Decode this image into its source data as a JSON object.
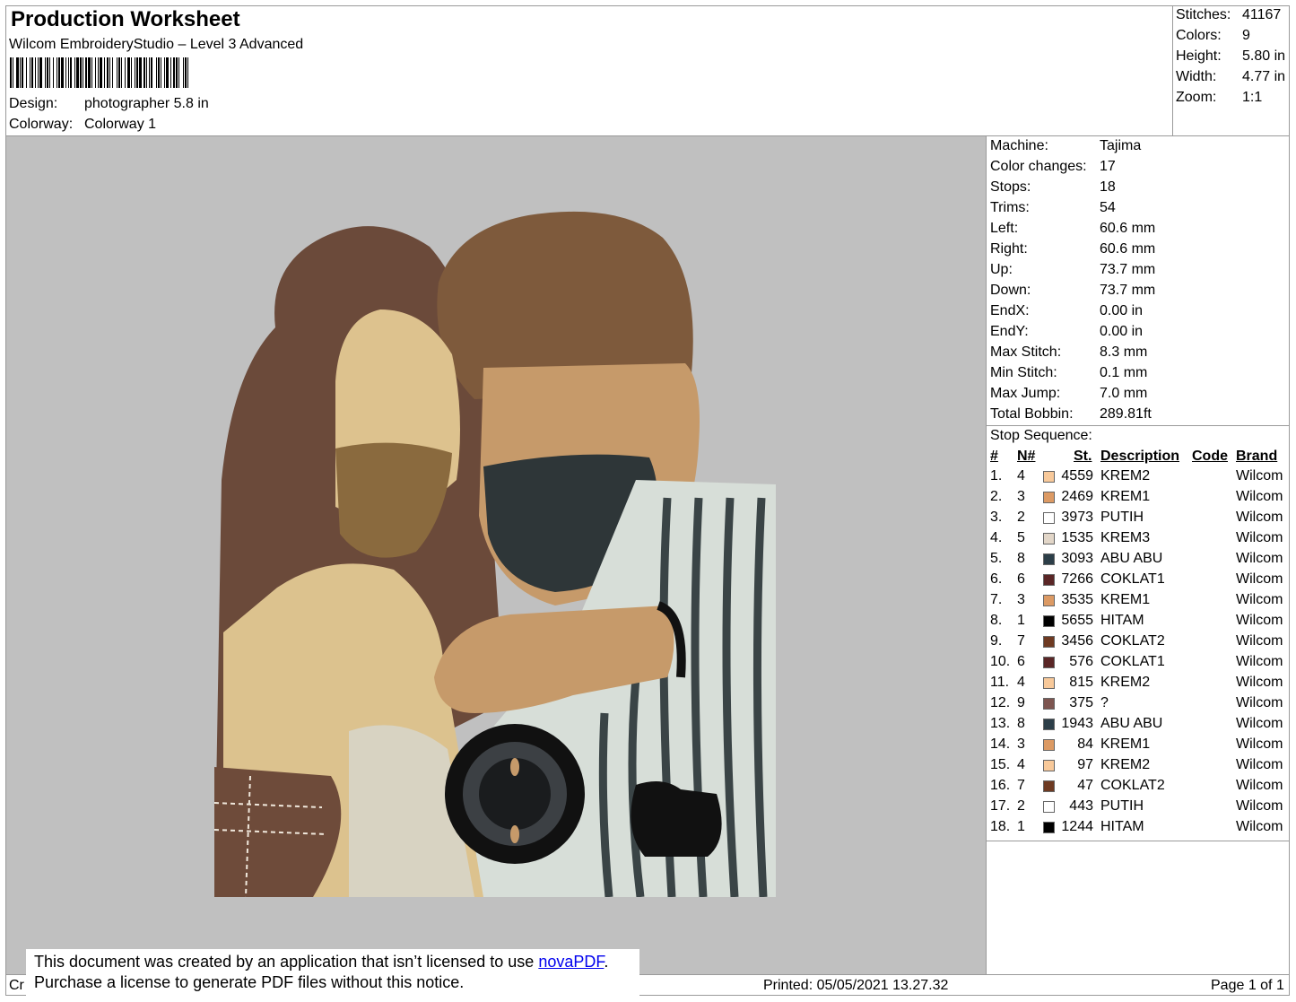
{
  "header": {
    "title": "Production Worksheet",
    "software": "Wilcom EmbroideryStudio – Level 3 Advanced",
    "design_label": "Design:",
    "design_value": "photographer 5.8 in",
    "colorway_label": "Colorway:",
    "colorway_value": "Colorway 1"
  },
  "stats": [
    {
      "label": "Stitches:",
      "value": "41167"
    },
    {
      "label": "Colors:",
      "value": "9"
    },
    {
      "label": "Height:",
      "value": "5.80 in"
    },
    {
      "label": "Width:",
      "value": "4.77 in"
    },
    {
      "label": "Zoom:",
      "value": "1:1"
    }
  ],
  "machine_info": [
    {
      "label": "Machine:",
      "value": "Tajima"
    },
    {
      "label": "Color changes:",
      "value": "17"
    },
    {
      "label": "Stops:",
      "value": "18"
    },
    {
      "label": "Trims:",
      "value": "54"
    },
    {
      "label": "Left:",
      "value": "60.6 mm"
    },
    {
      "label": "Right:",
      "value": "60.6 mm"
    },
    {
      "label": "Up:",
      "value": "73.7 mm"
    },
    {
      "label": "Down:",
      "value": "73.7 mm"
    },
    {
      "label": "EndX:",
      "value": "0.00 in"
    },
    {
      "label": "EndY:",
      "value": "0.00 in"
    },
    {
      "label": "Max Stitch:",
      "value": "8.3 mm"
    },
    {
      "label": "Min Stitch:",
      "value": "0.1 mm"
    },
    {
      "label": "Max Jump:",
      "value": "7.0 mm"
    },
    {
      "label": "Total Bobbin:",
      "value": "289.81ft"
    }
  ],
  "stop_sequence": {
    "title": "Stop Sequence:",
    "columns": [
      "#",
      "N#",
      "St.",
      "Description",
      "Code",
      "Brand"
    ],
    "rows": [
      {
        "num": "1.",
        "n": "4",
        "color": "#f8c99a",
        "st": "4559",
        "desc": "KREM2",
        "code": "",
        "brand": "Wilcom"
      },
      {
        "num": "2.",
        "n": "3",
        "color": "#dc9a64",
        "st": "2469",
        "desc": "KREM1",
        "code": "",
        "brand": "Wilcom"
      },
      {
        "num": "3.",
        "n": "2",
        "color": "#ffffff",
        "st": "3973",
        "desc": "PUTIH",
        "code": "",
        "brand": "Wilcom"
      },
      {
        "num": "4.",
        "n": "5",
        "color": "#e2d6c8",
        "st": "1535",
        "desc": "KREM3",
        "code": "",
        "brand": "Wilcom"
      },
      {
        "num": "5.",
        "n": "8",
        "color": "#2c3e48",
        "st": "3093",
        "desc": "ABU ABU",
        "code": "",
        "brand": "Wilcom"
      },
      {
        "num": "6.",
        "n": "6",
        "color": "#5a2626",
        "st": "7266",
        "desc": "COKLAT1",
        "code": "",
        "brand": "Wilcom"
      },
      {
        "num": "7.",
        "n": "3",
        "color": "#dc9a64",
        "st": "3535",
        "desc": "KREM1",
        "code": "",
        "brand": "Wilcom"
      },
      {
        "num": "8.",
        "n": "1",
        "color": "#000000",
        "st": "5655",
        "desc": "HITAM",
        "code": "",
        "brand": "Wilcom"
      },
      {
        "num": "9.",
        "n": "7",
        "color": "#6e3a22",
        "st": "3456",
        "desc": "COKLAT2",
        "code": "",
        "brand": "Wilcom"
      },
      {
        "num": "10.",
        "n": "6",
        "color": "#5a2626",
        "st": "576",
        "desc": "COKLAT1",
        "code": "",
        "brand": "Wilcom"
      },
      {
        "num": "11.",
        "n": "4",
        "color": "#f8c99a",
        "st": "815",
        "desc": "KREM2",
        "code": "",
        "brand": "Wilcom"
      },
      {
        "num": "12.",
        "n": "9",
        "color": "#7d5550",
        "st": "375",
        "desc": "?",
        "code": "",
        "brand": "Wilcom"
      },
      {
        "num": "13.",
        "n": "8",
        "color": "#2c3e48",
        "st": "1943",
        "desc": "ABU ABU",
        "code": "",
        "brand": "Wilcom"
      },
      {
        "num": "14.",
        "n": "3",
        "color": "#dc9a64",
        "st": "84",
        "desc": "KREM1",
        "code": "",
        "brand": "Wilcom"
      },
      {
        "num": "15.",
        "n": "4",
        "color": "#f8c99a",
        "st": "97",
        "desc": "KREM2",
        "code": "",
        "brand": "Wilcom"
      },
      {
        "num": "16.",
        "n": "7",
        "color": "#6e3a22",
        "st": "47",
        "desc": "COKLAT2",
        "code": "",
        "brand": "Wilcom"
      },
      {
        "num": "17.",
        "n": "2",
        "color": "#ffffff",
        "st": "443",
        "desc": "PUTIH",
        "code": "",
        "brand": "Wilcom"
      },
      {
        "num": "18.",
        "n": "1",
        "color": "#000000",
        "st": "1244",
        "desc": "HITAM",
        "code": "",
        "brand": "Wilcom"
      }
    ]
  },
  "footer": {
    "cut_text": "Cr",
    "notice_line1": "This document was created by an application that isn’t licensed to use ",
    "notice_link": "novaPDF",
    "notice_line1_end": ".",
    "notice_line2": "Purchase a license to generate PDF files without this notice.",
    "printed": "Printed: 05/05/2021 13.27.32",
    "page": "Page 1 of 1"
  }
}
